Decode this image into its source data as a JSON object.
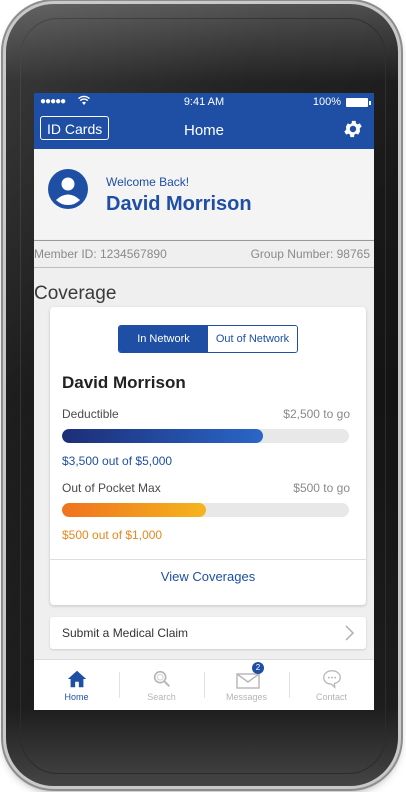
{
  "status_bar": {
    "signal": "●●●●●",
    "time": "9:41 AM",
    "battery": "100%"
  },
  "nav": {
    "id_cards_label": "ID Cards",
    "title": "Home",
    "settings_icon": "gear-icon"
  },
  "welcome": {
    "greeting": "Welcome Back!",
    "name": "David Morrison",
    "member_id": "Member ID: 1234567890",
    "group_number": "Group Number: 98765"
  },
  "coverage": {
    "section_title": "Coverage",
    "tabs": [
      {
        "label": "In Network",
        "active": true
      },
      {
        "label": "Out of Network",
        "active": false
      }
    ],
    "member_name": "David Morrison",
    "deductible": {
      "label": "Deductible",
      "remaining": "$2,500 to go",
      "amount_text": "$3,500 out of $5,000",
      "progress": 0.7
    },
    "out_of_pocket": {
      "label": "Out of Pocket Max",
      "remaining": "$500 to go",
      "amount_text": "$500 out of $1,000",
      "progress": 0.5
    },
    "view_coverages_label": "View Coverages"
  },
  "claim": {
    "label": "Submit a Medical Claim"
  },
  "tabbar": {
    "items": [
      {
        "label": "Home",
        "icon": "home-icon",
        "active": true
      },
      {
        "label": "Search",
        "icon": "search-icon",
        "active": false
      },
      {
        "label": "Messages",
        "icon": "envelope-icon",
        "active": false,
        "badge": "2"
      },
      {
        "label": "Contact",
        "icon": "chat-bubble-icon",
        "active": false
      }
    ]
  },
  "colors": {
    "brand_blue": "#1e4fa5",
    "deductible_bar": "#2a66c8",
    "oop_bar": "#f5a01e"
  }
}
